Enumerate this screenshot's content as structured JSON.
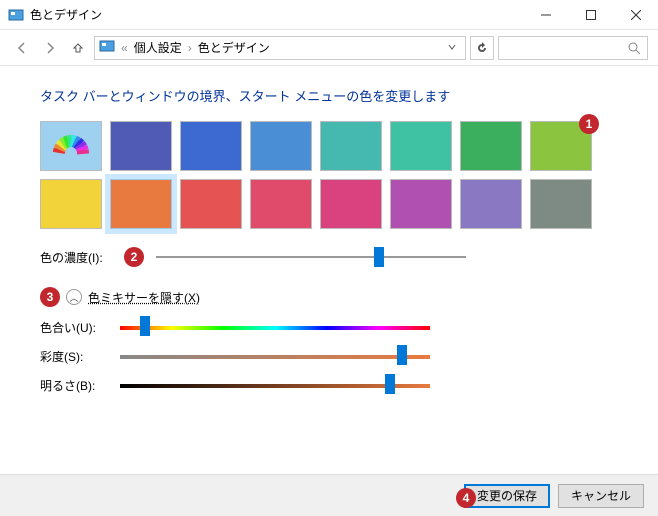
{
  "window": {
    "title": "色とデザイン"
  },
  "breadcrumbs": {
    "root_glyph": "«",
    "item1": "個人設定",
    "item2": "色とデザイン"
  },
  "heading": "タスク バーとウィンドウの境界、スタート メニューの色を変更します",
  "swatches": {
    "row1": [
      "auto",
      "#4f5bb5",
      "#3c6ad1",
      "#4a8fd6",
      "#45b9b0",
      "#3fc1a3",
      "#3caf5f",
      "#8bc540"
    ],
    "row2": [
      "#f2d43a",
      "#e87a3f",
      "#e55452",
      "#e04a6b",
      "#d9417f",
      "#b050b0",
      "#8b78c2",
      "#7d8b84"
    ],
    "selected_index": 9
  },
  "sliders": {
    "intensity": {
      "label": "色の濃度(I):",
      "value_pct": 72
    },
    "hue": {
      "label": "色合い(U):",
      "value_pct": 8
    },
    "sat": {
      "label": "彩度(S):",
      "value_pct": 91
    },
    "lgt": {
      "label": "明るさ(B):",
      "value_pct": 87
    }
  },
  "mixer_toggle": "色ミキサーを隠す(X)",
  "buttons": {
    "save": "変更の保存",
    "cancel": "キャンセル"
  },
  "badges": {
    "b1": "1",
    "b2": "2",
    "b3": "3",
    "b4": "4"
  }
}
